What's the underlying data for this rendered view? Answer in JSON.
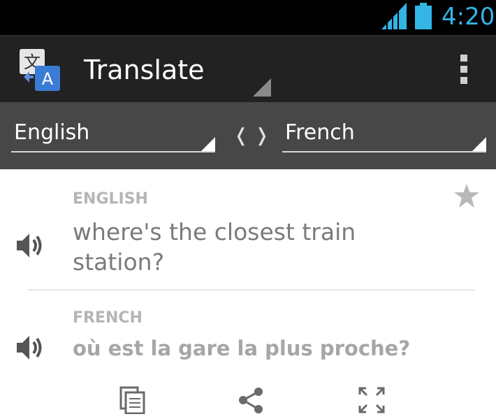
{
  "status_bar": {
    "time": "4:20",
    "signal_icon": "signal-icon",
    "battery_icon": "battery-icon",
    "accent_color": "#33b5e5"
  },
  "action_bar": {
    "logo_icon": "translate-logo-icon",
    "title": "Translate",
    "overflow_icon": "overflow-menu-icon"
  },
  "language_bar": {
    "source_language": "English",
    "target_language": "French",
    "swap_label": "❬ ❭"
  },
  "source": {
    "label": "ENGLISH",
    "text": "where's the closest train station?",
    "speaker_icon": "speaker-icon",
    "star_icon": "star-icon"
  },
  "translation": {
    "label": "FRENCH",
    "text": "où est la gare la plus proche?",
    "speaker_icon": "speaker-icon"
  },
  "bottom_actions": [
    {
      "icon": "copy-icon"
    },
    {
      "icon": "share-icon"
    },
    {
      "icon": "fullscreen-icon"
    }
  ]
}
